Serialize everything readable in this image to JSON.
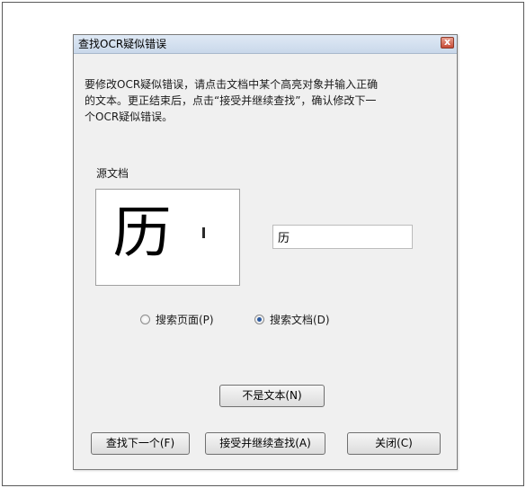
{
  "window": {
    "title": "查找OCR疑似错误",
    "close_glyph": "x"
  },
  "instructions": {
    "line1": "要修改OCR疑似错误，请点击文档中某个高亮对象并输入正确",
    "line2": "的文本。更正结束后，点击“接受并继续查找”，确认修改下一",
    "line3": "个OCR疑似错误。"
  },
  "source": {
    "label": "源文档",
    "preview_char": "历"
  },
  "correction": {
    "value": "历"
  },
  "search_scope": {
    "options": [
      {
        "label": "搜索页面(P)",
        "checked": false
      },
      {
        "label": "搜索文档(D)",
        "checked": true
      }
    ]
  },
  "buttons": {
    "not_text": "不是文本(N)",
    "find_next": "查找下一个(F)",
    "accept_continue": "接受并继续查找(A)",
    "close": "关闭(C)"
  },
  "colors": {
    "titlebar": "#d4e1f0",
    "close_button": "#c64a36",
    "dialog_bg": "#f0f0f0",
    "radio_selected": "#2c5aa0"
  }
}
